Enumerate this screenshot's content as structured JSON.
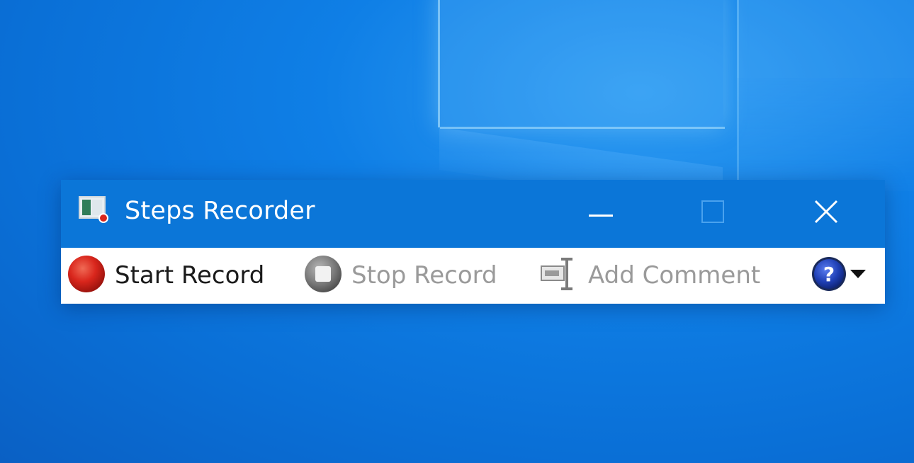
{
  "window": {
    "title": "Steps Recorder",
    "icon": "steps-recorder-app-icon"
  },
  "titlebar_buttons": {
    "minimize_icon": "minimize-icon",
    "maximize_icon": "maximize-icon",
    "close_icon": "close-icon"
  },
  "toolbar": {
    "start_label": "Start Record",
    "start_icon": "record-icon",
    "stop_label": "Stop Record",
    "stop_icon": "stop-icon",
    "comment_label": "Add Comment",
    "comment_icon": "comment-icon",
    "help_icon": "help-icon",
    "help_menu_icon": "dropdown-arrow-icon"
  },
  "colors": {
    "titlebar": "#0b76d8",
    "toolbar_bg": "#ffffff",
    "record_red": "#d9261c",
    "disabled_text": "#9a9a9a",
    "help_blue": "#1f3fb5"
  }
}
